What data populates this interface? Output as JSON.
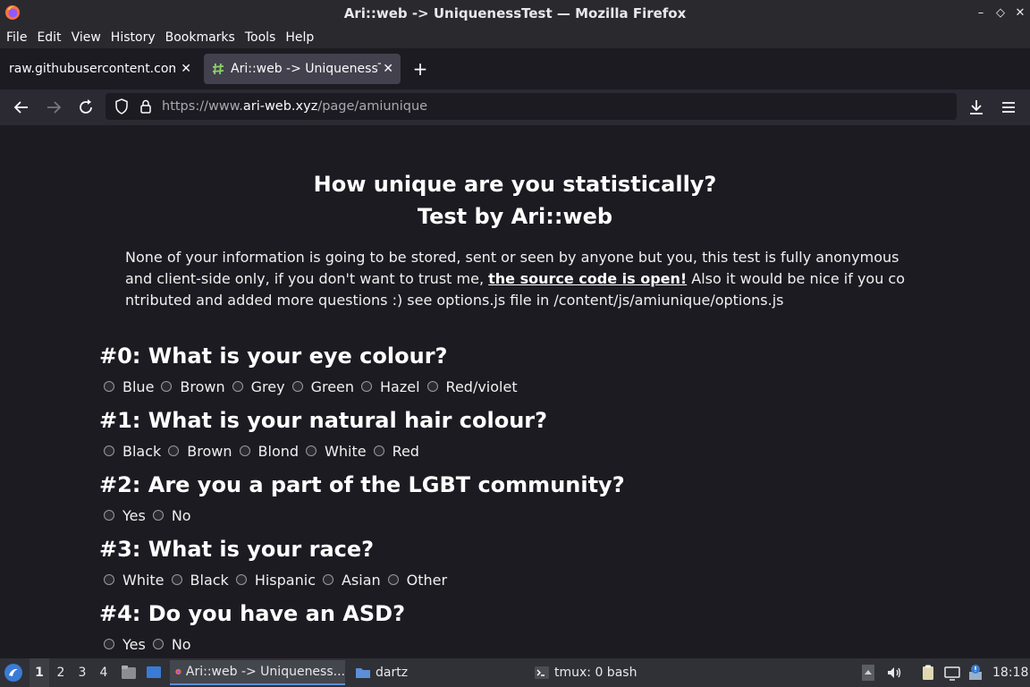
{
  "window": {
    "title": "Ari::web -> UniquenessTest — Mozilla Firefox",
    "minimize": "–",
    "restore": "◇",
    "close": "✕"
  },
  "menubar": [
    "File",
    "Edit",
    "View",
    "History",
    "Bookmarks",
    "Tools",
    "Help"
  ],
  "tabs": [
    {
      "label": "raw.githubusercontent.com/r",
      "close": "✕",
      "active": false
    },
    {
      "label": "Ari::web -> UniquenessTest",
      "close": "✕",
      "active": true
    }
  ],
  "newtab": "+",
  "navbar": {
    "url_prefix": "https://www.",
    "url_host": "ari-web.xyz",
    "url_path": "/page/amiunique"
  },
  "page": {
    "title_line1": "How unique are you statistically?",
    "title_line2": "Test by Ari::web",
    "intro_before": "None of your information is going to be stored, sent or seen by anyone but you, this test is fully anonymous and client-side only, if you don't want to trust me, ",
    "intro_link": "the source code is open!",
    "intro_after": " Also it would be nice if you co ntributed and added more questions :) see options.js file in /content/js/amiunique/options.js",
    "questions": [
      {
        "title": "#0: What is your eye colour?",
        "options": [
          "Blue",
          "Brown",
          "Grey",
          "Green",
          "Hazel",
          "Red/violet"
        ]
      },
      {
        "title": "#1: What is your natural hair colour?",
        "options": [
          "Black",
          "Brown",
          "Blond",
          "White",
          "Red"
        ]
      },
      {
        "title": "#2: Are you a part of the LGBT community?",
        "options": [
          "Yes",
          "No"
        ]
      },
      {
        "title": "#3: What is your race?",
        "options": [
          "White",
          "Black",
          "Hispanic",
          "Asian",
          "Other"
        ]
      },
      {
        "title": "#4: Do you have an ASD?",
        "options": [
          "Yes",
          "No"
        ]
      }
    ]
  },
  "taskbar": {
    "workspaces": [
      "1",
      "2",
      "3",
      "4"
    ],
    "active_workspace": "1",
    "tasks": [
      "Ari::web -> Uniqueness...",
      "dartz",
      "tmux: 0 bash"
    ],
    "clock": "18:18"
  },
  "colors": {
    "background": "#1c1b22",
    "toolbar": "#2b2a33",
    "active_tab": "#42414d"
  }
}
